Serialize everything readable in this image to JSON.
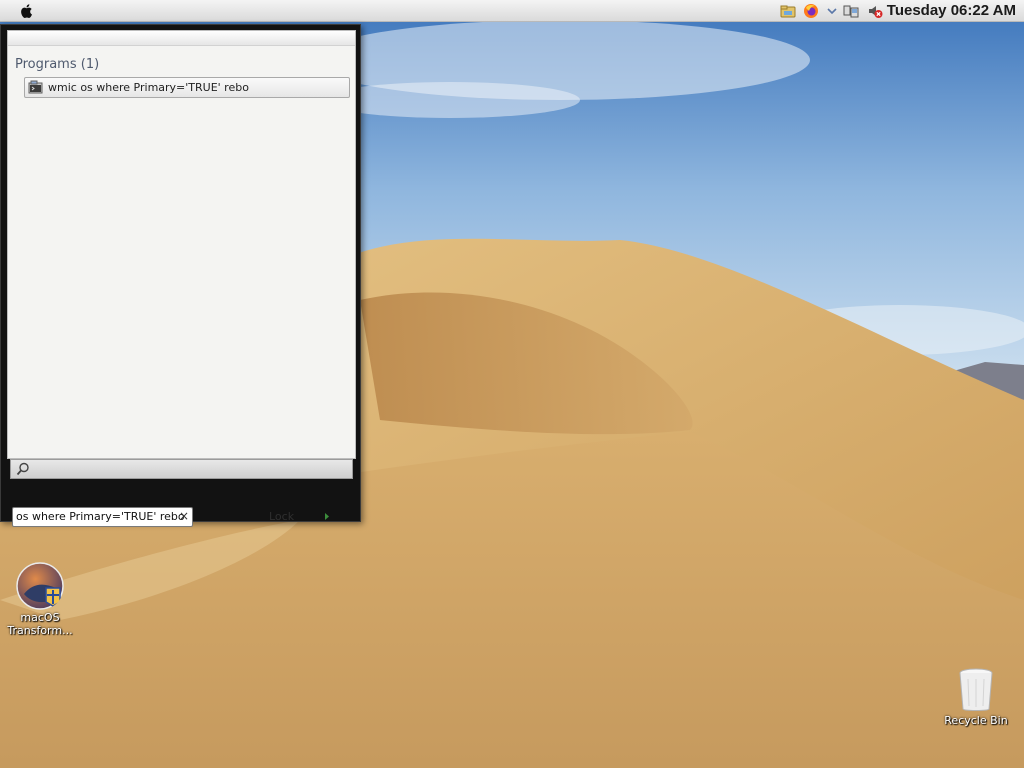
{
  "menubar": {
    "clock": "Tuesday 06:22 AM",
    "icons": [
      "apple-icon",
      "network-folder-icon",
      "firefox-icon",
      "chevron-down-icon",
      "network-icon",
      "volume-muted-icon"
    ]
  },
  "start_menu": {
    "programs_header": "Programs (1)",
    "program_items": [
      {
        "label": "wmic os where Primary='TRUE' rebo",
        "icon": "console-program-icon"
      }
    ],
    "search_value": "os where Primary='TRUE' rebo",
    "clear_symbol": "×",
    "lock_label": "Lock"
  },
  "desktop_icons": [
    {
      "label": "macOS Transform...",
      "icon": "macos-transformation-pack-icon"
    },
    {
      "label": "Recycle Bin",
      "icon": "recycle-bin-icon"
    }
  ],
  "colors": {
    "menubar": "#e6e6e6",
    "start_menu_frame": "#121212",
    "panel": "#f4f4f2",
    "accent_text": "#4f5a6e"
  }
}
